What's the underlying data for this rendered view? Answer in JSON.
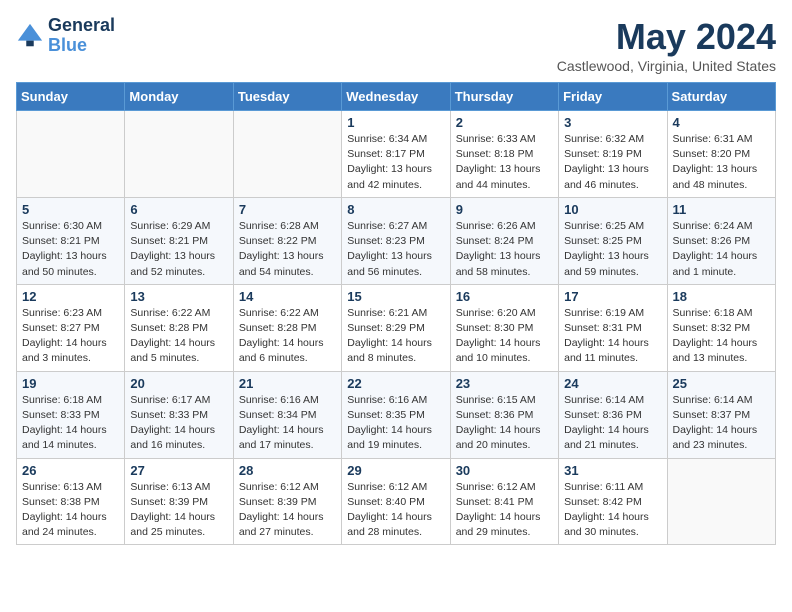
{
  "header": {
    "logo_line1": "General",
    "logo_line2": "Blue",
    "month": "May 2024",
    "location": "Castlewood, Virginia, United States"
  },
  "weekdays": [
    "Sunday",
    "Monday",
    "Tuesday",
    "Wednesday",
    "Thursday",
    "Friday",
    "Saturday"
  ],
  "weeks": [
    [
      {
        "day": "",
        "info": ""
      },
      {
        "day": "",
        "info": ""
      },
      {
        "day": "",
        "info": ""
      },
      {
        "day": "1",
        "info": "Sunrise: 6:34 AM\nSunset: 8:17 PM\nDaylight: 13 hours\nand 42 minutes."
      },
      {
        "day": "2",
        "info": "Sunrise: 6:33 AM\nSunset: 8:18 PM\nDaylight: 13 hours\nand 44 minutes."
      },
      {
        "day": "3",
        "info": "Sunrise: 6:32 AM\nSunset: 8:19 PM\nDaylight: 13 hours\nand 46 minutes."
      },
      {
        "day": "4",
        "info": "Sunrise: 6:31 AM\nSunset: 8:20 PM\nDaylight: 13 hours\nand 48 minutes."
      }
    ],
    [
      {
        "day": "5",
        "info": "Sunrise: 6:30 AM\nSunset: 8:21 PM\nDaylight: 13 hours\nand 50 minutes."
      },
      {
        "day": "6",
        "info": "Sunrise: 6:29 AM\nSunset: 8:21 PM\nDaylight: 13 hours\nand 52 minutes."
      },
      {
        "day": "7",
        "info": "Sunrise: 6:28 AM\nSunset: 8:22 PM\nDaylight: 13 hours\nand 54 minutes."
      },
      {
        "day": "8",
        "info": "Sunrise: 6:27 AM\nSunset: 8:23 PM\nDaylight: 13 hours\nand 56 minutes."
      },
      {
        "day": "9",
        "info": "Sunrise: 6:26 AM\nSunset: 8:24 PM\nDaylight: 13 hours\nand 58 minutes."
      },
      {
        "day": "10",
        "info": "Sunrise: 6:25 AM\nSunset: 8:25 PM\nDaylight: 13 hours\nand 59 minutes."
      },
      {
        "day": "11",
        "info": "Sunrise: 6:24 AM\nSunset: 8:26 PM\nDaylight: 14 hours\nand 1 minute."
      }
    ],
    [
      {
        "day": "12",
        "info": "Sunrise: 6:23 AM\nSunset: 8:27 PM\nDaylight: 14 hours\nand 3 minutes."
      },
      {
        "day": "13",
        "info": "Sunrise: 6:22 AM\nSunset: 8:28 PM\nDaylight: 14 hours\nand 5 minutes."
      },
      {
        "day": "14",
        "info": "Sunrise: 6:22 AM\nSunset: 8:28 PM\nDaylight: 14 hours\nand 6 minutes."
      },
      {
        "day": "15",
        "info": "Sunrise: 6:21 AM\nSunset: 8:29 PM\nDaylight: 14 hours\nand 8 minutes."
      },
      {
        "day": "16",
        "info": "Sunrise: 6:20 AM\nSunset: 8:30 PM\nDaylight: 14 hours\nand 10 minutes."
      },
      {
        "day": "17",
        "info": "Sunrise: 6:19 AM\nSunset: 8:31 PM\nDaylight: 14 hours\nand 11 minutes."
      },
      {
        "day": "18",
        "info": "Sunrise: 6:18 AM\nSunset: 8:32 PM\nDaylight: 14 hours\nand 13 minutes."
      }
    ],
    [
      {
        "day": "19",
        "info": "Sunrise: 6:18 AM\nSunset: 8:33 PM\nDaylight: 14 hours\nand 14 minutes."
      },
      {
        "day": "20",
        "info": "Sunrise: 6:17 AM\nSunset: 8:33 PM\nDaylight: 14 hours\nand 16 minutes."
      },
      {
        "day": "21",
        "info": "Sunrise: 6:16 AM\nSunset: 8:34 PM\nDaylight: 14 hours\nand 17 minutes."
      },
      {
        "day": "22",
        "info": "Sunrise: 6:16 AM\nSunset: 8:35 PM\nDaylight: 14 hours\nand 19 minutes."
      },
      {
        "day": "23",
        "info": "Sunrise: 6:15 AM\nSunset: 8:36 PM\nDaylight: 14 hours\nand 20 minutes."
      },
      {
        "day": "24",
        "info": "Sunrise: 6:14 AM\nSunset: 8:36 PM\nDaylight: 14 hours\nand 21 minutes."
      },
      {
        "day": "25",
        "info": "Sunrise: 6:14 AM\nSunset: 8:37 PM\nDaylight: 14 hours\nand 23 minutes."
      }
    ],
    [
      {
        "day": "26",
        "info": "Sunrise: 6:13 AM\nSunset: 8:38 PM\nDaylight: 14 hours\nand 24 minutes."
      },
      {
        "day": "27",
        "info": "Sunrise: 6:13 AM\nSunset: 8:39 PM\nDaylight: 14 hours\nand 25 minutes."
      },
      {
        "day": "28",
        "info": "Sunrise: 6:12 AM\nSunset: 8:39 PM\nDaylight: 14 hours\nand 27 minutes."
      },
      {
        "day": "29",
        "info": "Sunrise: 6:12 AM\nSunset: 8:40 PM\nDaylight: 14 hours\nand 28 minutes."
      },
      {
        "day": "30",
        "info": "Sunrise: 6:12 AM\nSunset: 8:41 PM\nDaylight: 14 hours\nand 29 minutes."
      },
      {
        "day": "31",
        "info": "Sunrise: 6:11 AM\nSunset: 8:42 PM\nDaylight: 14 hours\nand 30 minutes."
      },
      {
        "day": "",
        "info": ""
      }
    ]
  ]
}
